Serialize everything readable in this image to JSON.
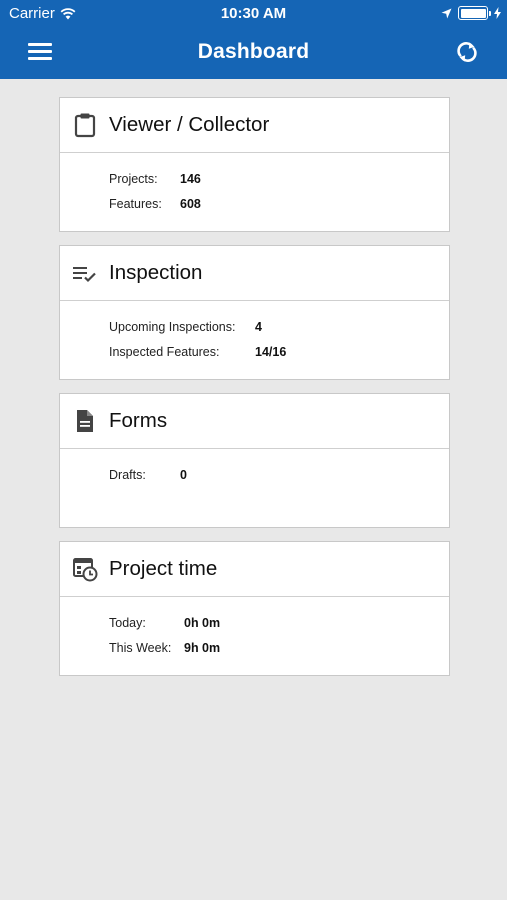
{
  "status_bar": {
    "carrier": "Carrier",
    "time": "10:30 AM"
  },
  "header": {
    "title": "Dashboard",
    "menu_icon": "hamburger-menu-icon",
    "sync_icon": "sync-icon",
    "background_color": "#1565b5"
  },
  "cards": [
    {
      "title": "Viewer / Collector",
      "icon": "clipboard-icon",
      "rows": [
        {
          "label": "Projects:",
          "value": "146"
        },
        {
          "label": "Features:",
          "value": "608"
        }
      ]
    },
    {
      "title": "Inspection",
      "icon": "checklist-icon",
      "rows": [
        {
          "label": "Upcoming Inspections:",
          "value": "4"
        },
        {
          "label": "Inspected Features:",
          "value": "14/16"
        }
      ]
    },
    {
      "title": "Forms",
      "icon": "document-icon",
      "rows": [
        {
          "label": "Drafts:",
          "value": "0"
        }
      ]
    },
    {
      "title": "Project time",
      "icon": "calendar-clock-icon",
      "rows": [
        {
          "label": "Today:",
          "value": "0h 0m"
        },
        {
          "label": "This Week:",
          "value": "9h 0m"
        }
      ]
    }
  ]
}
